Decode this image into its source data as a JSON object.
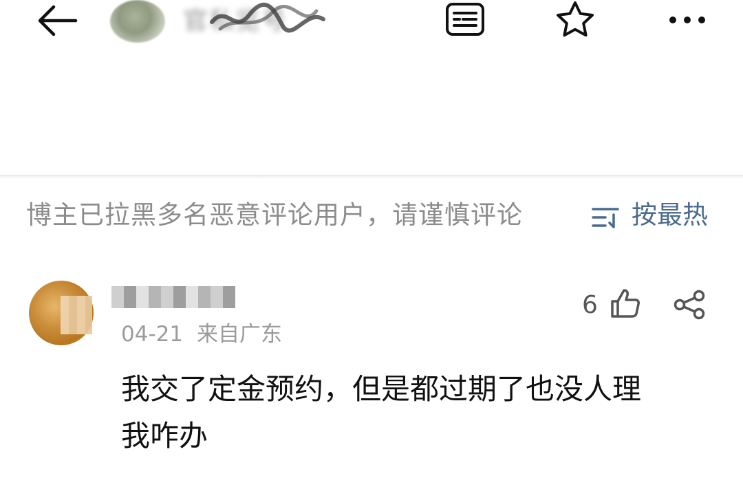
{
  "header": {
    "channel_name": "官私览号",
    "icons": {
      "back": "arrow-left-icon",
      "list": "document-list-icon",
      "star": "star-outline-icon",
      "more": "more-dots-icon"
    }
  },
  "comments_section": {
    "notice": "博主已拉黑多名恶意评论用户，请谨慎评论",
    "sort_label": "按最热",
    "sort_icon": "sort-icon",
    "accent_color": "#4a6b8f"
  },
  "comment": {
    "username": "████████",
    "date": "04-21",
    "location": "来自广东",
    "likes": "6",
    "text": "我交了定金预约，但是都过期了也没人理\n我咋办",
    "icons": {
      "like": "thumbs-up-icon",
      "share": "share-icon"
    }
  }
}
